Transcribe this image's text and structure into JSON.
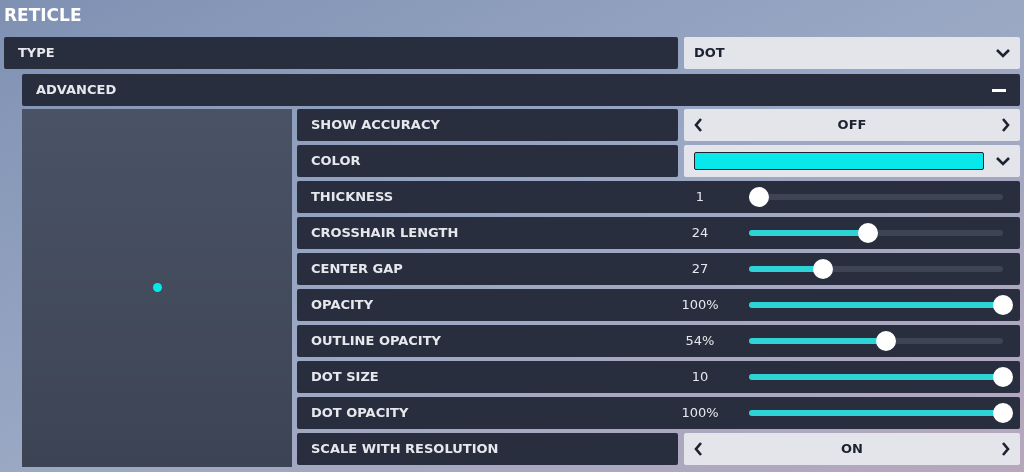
{
  "title": "RETICLE",
  "type": {
    "label": "TYPE",
    "value": "DOT"
  },
  "advanced": {
    "label": "ADVANCED",
    "expanded": true
  },
  "settings": [
    {
      "kind": "toggle",
      "label": "SHOW ACCURACY",
      "value": "OFF"
    },
    {
      "kind": "color",
      "label": "COLOR",
      "color": "#08e8ea"
    },
    {
      "kind": "slider",
      "label": "THICKNESS",
      "reading": "1",
      "level": 0.04
    },
    {
      "kind": "slider",
      "label": "CROSSHAIR LENGTH",
      "reading": "24",
      "level": 0.47
    },
    {
      "kind": "slider",
      "label": "CENTER GAP",
      "reading": "27",
      "level": 0.29
    },
    {
      "kind": "slider",
      "label": "OPACITY",
      "reading": "100%",
      "level": 1
    },
    {
      "kind": "slider",
      "label": "OUTLINE OPACITY",
      "reading": "54%",
      "level": 0.54
    },
    {
      "kind": "slider",
      "label": "DOT SIZE",
      "reading": "10",
      "level": 1
    },
    {
      "kind": "slider",
      "label": "DOT OPACITY",
      "reading": "100%",
      "level": 1
    },
    {
      "kind": "toggle",
      "label": "SCALE WITH RESOLUTION",
      "value": "ON"
    }
  ]
}
